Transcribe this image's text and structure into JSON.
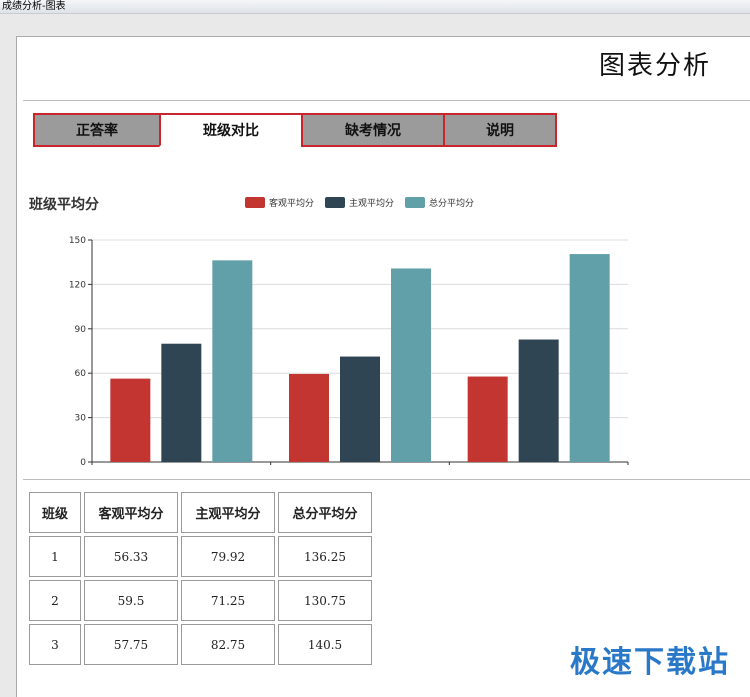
{
  "window": {
    "title": "成绩分析-图表"
  },
  "page": {
    "title": "图表分析"
  },
  "tabs": [
    {
      "label": "正答率",
      "active": false
    },
    {
      "label": "班级对比",
      "active": true
    },
    {
      "label": "缺考情况",
      "active": false
    },
    {
      "label": "说明",
      "active": false
    }
  ],
  "chart_data": {
    "type": "bar",
    "title": "班级平均分",
    "categories": [
      "1",
      "2",
      "3"
    ],
    "series": [
      {
        "name": "客观平均分",
        "color": "#c23531",
        "values": [
          56.33,
          59.5,
          57.75
        ]
      },
      {
        "name": "主观平均分",
        "color": "#2f4554",
        "values": [
          79.92,
          71.25,
          82.75
        ]
      },
      {
        "name": "总分平均分",
        "color": "#61a0a8",
        "values": [
          136.25,
          130.75,
          140.5
        ]
      }
    ],
    "ylim": [
      0,
      150
    ],
    "yticks": [
      "0",
      "30",
      "60",
      "90",
      "120",
      "150"
    ],
    "grid": true,
    "legend": "top-center"
  },
  "table": {
    "headers": [
      "班级",
      "客观平均分",
      "主观平均分",
      "总分平均分"
    ],
    "rows": [
      [
        "1",
        "56.33",
        "79.92",
        "136.25"
      ],
      [
        "2",
        "59.5",
        "71.25",
        "130.75"
      ],
      [
        "3",
        "57.75",
        "82.75",
        "140.5"
      ]
    ]
  },
  "watermark": "极速下载站"
}
